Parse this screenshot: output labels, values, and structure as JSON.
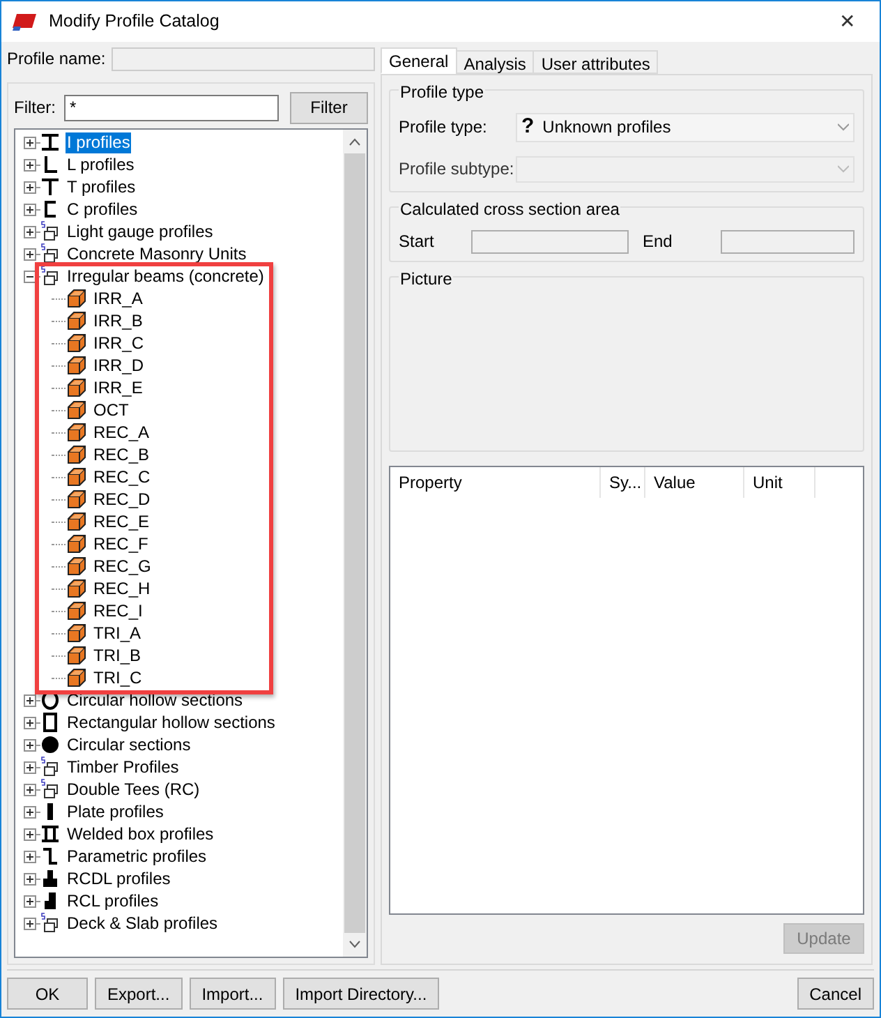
{
  "window": {
    "title": "Modify Profile Catalog",
    "close": "✕"
  },
  "profile_name": {
    "label": "Profile name:"
  },
  "filter": {
    "label": "Filter:",
    "value": "*",
    "button": "Filter"
  },
  "tree": [
    {
      "label": "I profiles",
      "kind": "i",
      "expanded": false,
      "selected": true
    },
    {
      "label": "L profiles",
      "kind": "l",
      "expanded": false,
      "selected": false
    },
    {
      "label": "T profiles",
      "kind": "t",
      "expanded": false,
      "selected": false
    },
    {
      "label": "C profiles",
      "kind": "c",
      "expanded": false,
      "selected": false
    },
    {
      "label": "Light gauge profiles",
      "kind": "library",
      "expanded": false,
      "selected": false
    },
    {
      "label": "Concrete Masonry Units",
      "kind": "library",
      "expanded": false,
      "selected": false
    },
    {
      "label": "Irregular beams (concrete)",
      "kind": "library",
      "expanded": true,
      "selected": false,
      "children": [
        {
          "label": "IRR_A",
          "kind": "cube",
          "selected": false
        },
        {
          "label": "IRR_B",
          "kind": "cube",
          "selected": false
        },
        {
          "label": "IRR_C",
          "kind": "cube",
          "selected": false
        },
        {
          "label": "IRR_D",
          "kind": "cube",
          "selected": false
        },
        {
          "label": "IRR_E",
          "kind": "cube",
          "selected": false
        },
        {
          "label": "OCT",
          "kind": "cube",
          "selected": false
        },
        {
          "label": "REC_A",
          "kind": "cube",
          "selected": false
        },
        {
          "label": "REC_B",
          "kind": "cube",
          "selected": false
        },
        {
          "label": "REC_C",
          "kind": "cube",
          "selected": false
        },
        {
          "label": "REC_D",
          "kind": "cube",
          "selected": false
        },
        {
          "label": "REC_E",
          "kind": "cube",
          "selected": false
        },
        {
          "label": "REC_F",
          "kind": "cube",
          "selected": false
        },
        {
          "label": "REC_G",
          "kind": "cube",
          "selected": false
        },
        {
          "label": "REC_H",
          "kind": "cube",
          "selected": false
        },
        {
          "label": "REC_I",
          "kind": "cube",
          "selected": false
        },
        {
          "label": "TRI_A",
          "kind": "cube",
          "selected": false
        },
        {
          "label": "TRI_B",
          "kind": "cube",
          "selected": false
        },
        {
          "label": "TRI_C",
          "kind": "cube",
          "selected": false
        }
      ]
    },
    {
      "label": "Circular hollow sections",
      "kind": "ring",
      "expanded": false,
      "selected": false
    },
    {
      "label": "Rectangular hollow sections",
      "kind": "rect",
      "expanded": false,
      "selected": false
    },
    {
      "label": "Circular sections",
      "kind": "disc",
      "expanded": false,
      "selected": false
    },
    {
      "label": "Timber Profiles",
      "kind": "library",
      "expanded": false,
      "selected": false
    },
    {
      "label": "Double Tees (RC)",
      "kind": "library",
      "expanded": false,
      "selected": false
    },
    {
      "label": "Plate profiles",
      "kind": "plate",
      "expanded": false,
      "selected": false
    },
    {
      "label": "Welded box profiles",
      "kind": "welded",
      "expanded": false,
      "selected": false
    },
    {
      "label": "Parametric profiles",
      "kind": "parametric",
      "expanded": false,
      "selected": false
    },
    {
      "label": "RCDL profiles",
      "kind": "rcdl",
      "expanded": false,
      "selected": false
    },
    {
      "label": "RCL profiles",
      "kind": "rcl",
      "expanded": false,
      "selected": false
    },
    {
      "label": "Deck & Slab profiles",
      "kind": "library",
      "expanded": false,
      "selected": false
    }
  ],
  "tabs": [
    {
      "label": "General",
      "selected": true
    },
    {
      "label": "Analysis",
      "selected": false
    },
    {
      "label": "User attributes",
      "selected": false
    }
  ],
  "profile_type": {
    "title": "Profile type",
    "type_label": "Profile type:",
    "type_icon": "?",
    "type_value": "Unknown profiles",
    "subtype_label": "Profile subtype:",
    "subtype_disabled": true
  },
  "cross_section": {
    "title": "Calculated cross section area",
    "start_label": "Start",
    "end_label": "End"
  },
  "picture": {
    "title": "Picture"
  },
  "properties": {
    "columns": [
      "Property",
      "Sy...",
      "Value",
      "Unit"
    ]
  },
  "update_button": {
    "label": "Update",
    "disabled": true
  },
  "buttons": [
    "OK",
    "Export...",
    "Import...",
    "Import Directory...",
    "Cancel"
  ]
}
